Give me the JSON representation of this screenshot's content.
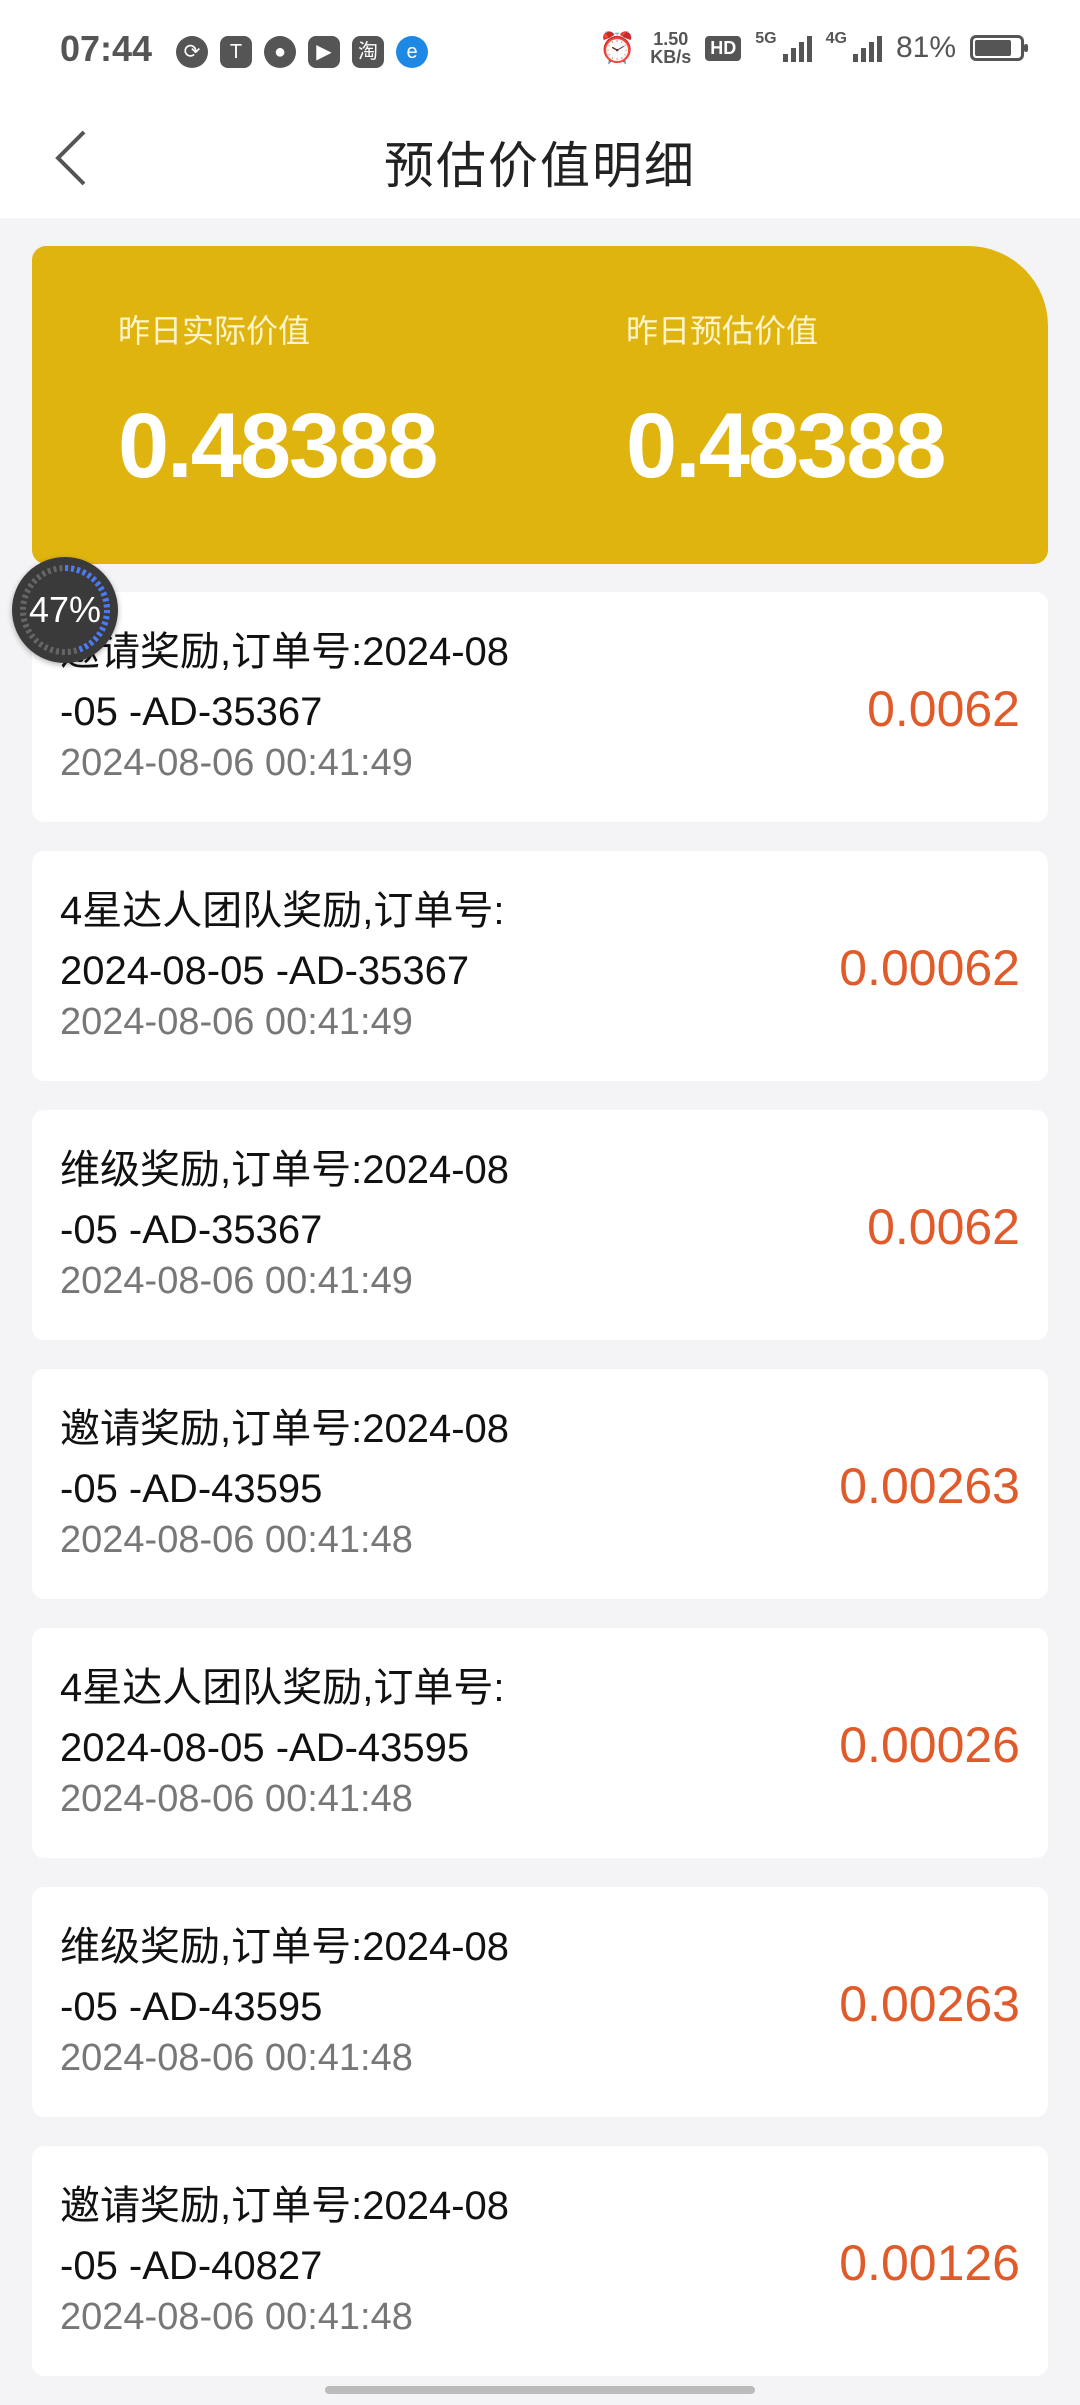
{
  "status_bar": {
    "time": "07:44",
    "app_icons": [
      "sync-icon",
      "t-app-icon",
      "wechat-icon",
      "video-app-icon",
      "taobao-icon",
      "edge-icon"
    ],
    "speed_value": "1.50",
    "speed_unit": "KB/s",
    "hd_label": "HD",
    "net_5g": "5G",
    "net_4g": "4G",
    "battery": "81%"
  },
  "header": {
    "title": "预估价值明细"
  },
  "summary": {
    "actual_label": "昨日实际价值",
    "actual_value": "0.48388",
    "estimated_label": "昨日预估价值",
    "estimated_value": "0.48388"
  },
  "floating_progress": {
    "percent_text": "47%",
    "progress": 0.47
  },
  "records": [
    {
      "line1": "邀请奖励,订单号:2024-08",
      "line2": "-05 -AD-35367",
      "time": "2024-08-06 00:41:49",
      "amount": "0.0062"
    },
    {
      "line1": "4星达人团队奖励,订单号:",
      "line2": "2024-08-05 -AD-35367",
      "time": "2024-08-06 00:41:49",
      "amount": "0.00062"
    },
    {
      "line1": "维级奖励,订单号:2024-08",
      "line2": "-05 -AD-35367",
      "time": "2024-08-06 00:41:49",
      "amount": "0.0062"
    },
    {
      "line1": "邀请奖励,订单号:2024-08",
      "line2": "-05 -AD-43595",
      "time": "2024-08-06 00:41:48",
      "amount": "0.00263"
    },
    {
      "line1": "4星达人团队奖励,订单号:",
      "line2": "2024-08-05 -AD-43595",
      "time": "2024-08-06 00:41:48",
      "amount": "0.00026"
    },
    {
      "line1": "维级奖励,订单号:2024-08",
      "line2": "-05 -AD-43595",
      "time": "2024-08-06 00:41:48",
      "amount": "0.00263"
    },
    {
      "line1": "邀请奖励,订单号:2024-08",
      "line2": "-05 -AD-40827",
      "time": "2024-08-06 00:41:48",
      "amount": "0.00126"
    }
  ],
  "colors": {
    "summary_bg": "#dfb40f",
    "amount": "#e05a2a",
    "page_bg": "#f4f4f6"
  }
}
